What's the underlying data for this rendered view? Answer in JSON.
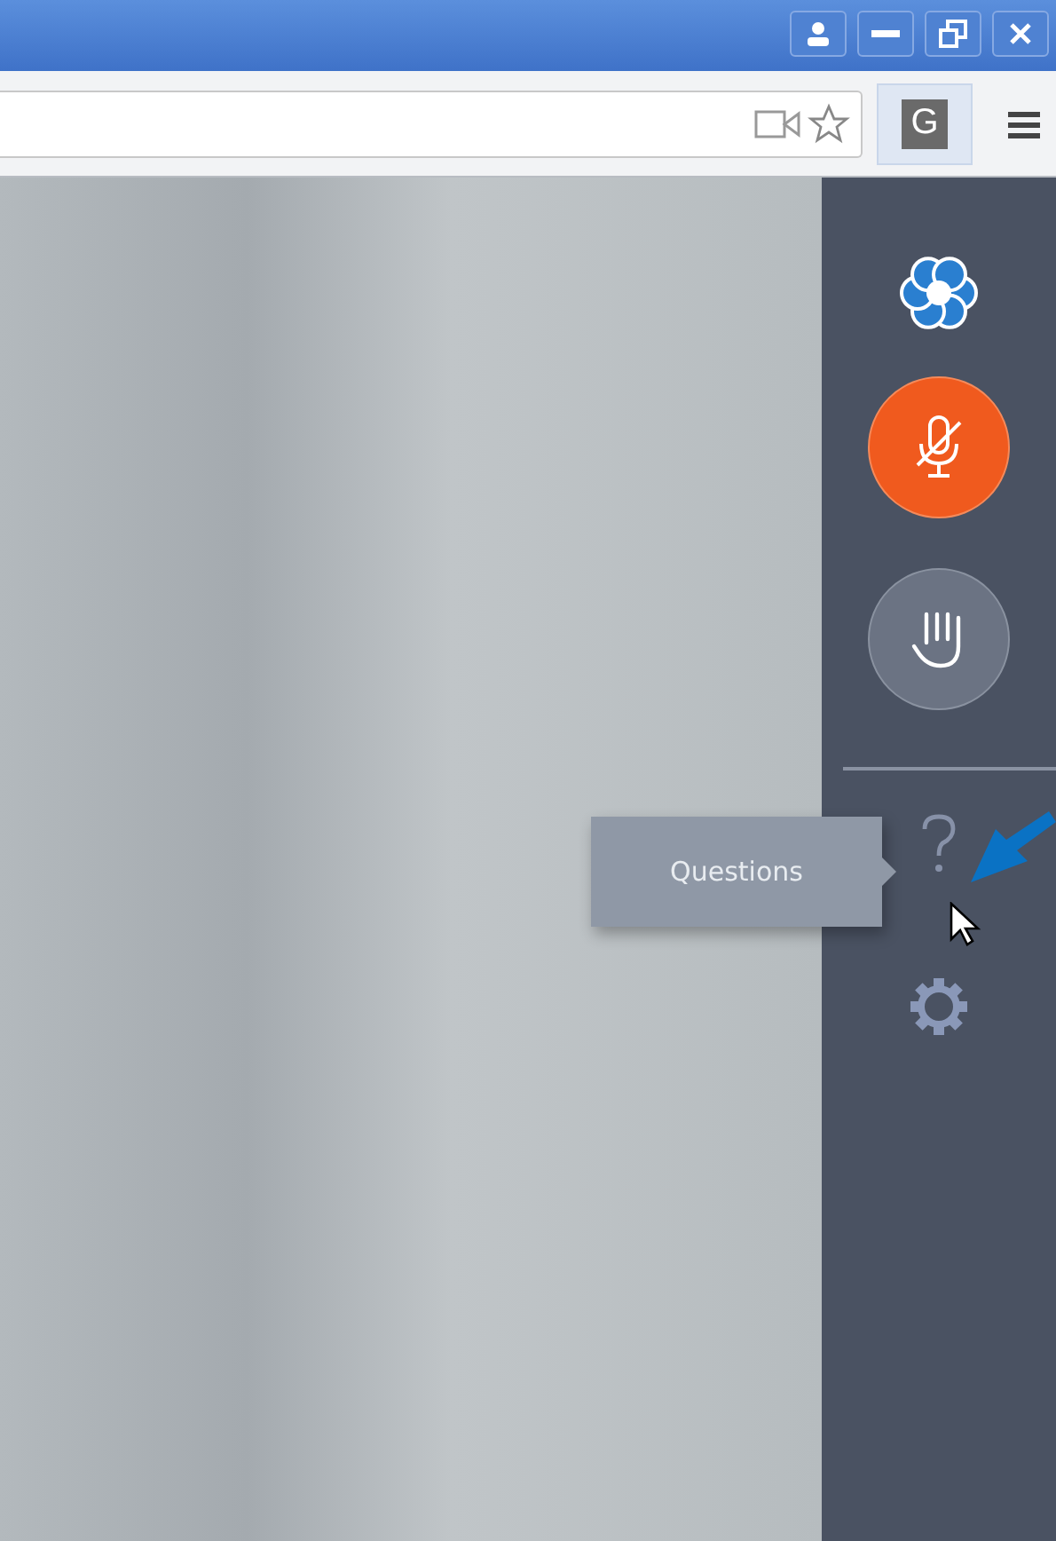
{
  "browser": {
    "extension_label": "G"
  },
  "sidebar": {
    "tooltip": "Questions"
  }
}
